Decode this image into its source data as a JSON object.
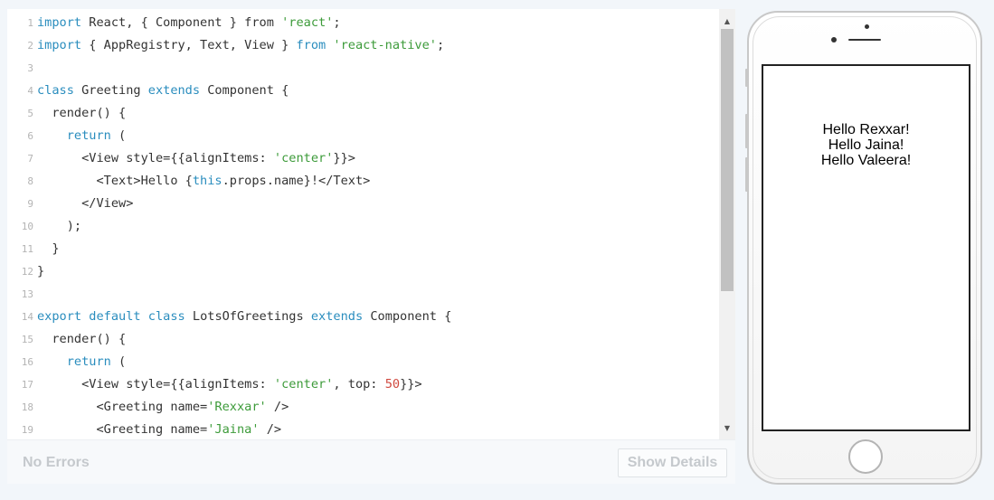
{
  "editor": {
    "lines": [
      [
        [
          "kw",
          "import"
        ],
        [
          "pl",
          " React, { Component } "
        ],
        [
          "pl",
          "from"
        ],
        [
          "pl",
          " "
        ],
        [
          "str",
          "'react'"
        ],
        [
          "pl",
          ";"
        ]
      ],
      [
        [
          "kw",
          "import"
        ],
        [
          "pl",
          " { AppRegistry, Text, View } "
        ],
        [
          "kw",
          "from"
        ],
        [
          "pl",
          " "
        ],
        [
          "str",
          "'react-native'"
        ],
        [
          "pl",
          ";"
        ]
      ],
      [],
      [
        [
          "kw",
          "class"
        ],
        [
          "pl",
          " Greeting "
        ],
        [
          "kw",
          "extends"
        ],
        [
          "pl",
          " Component {"
        ]
      ],
      [
        [
          "pl",
          "  render() {"
        ]
      ],
      [
        [
          "pl",
          "    "
        ],
        [
          "kw",
          "return"
        ],
        [
          "pl",
          " ("
        ]
      ],
      [
        [
          "pl",
          "      <View style={{alignItems: "
        ],
        [
          "str",
          "'center'"
        ],
        [
          "pl",
          "}}>"
        ]
      ],
      [
        [
          "pl",
          "        <Text>Hello {"
        ],
        [
          "kw",
          "this"
        ],
        [
          "pl",
          ".props.name}!</Text>"
        ]
      ],
      [
        [
          "pl",
          "      </View>"
        ]
      ],
      [
        [
          "pl",
          "    );"
        ]
      ],
      [
        [
          "pl",
          "  }"
        ]
      ],
      [
        [
          "pl",
          "}"
        ]
      ],
      [],
      [
        [
          "kw",
          "export"
        ],
        [
          "pl",
          " "
        ],
        [
          "kw",
          "default"
        ],
        [
          "pl",
          " "
        ],
        [
          "kw",
          "class"
        ],
        [
          "pl",
          " LotsOfGreetings "
        ],
        [
          "kw",
          "extends"
        ],
        [
          "pl",
          " Component {"
        ]
      ],
      [
        [
          "pl",
          "  render() {"
        ]
      ],
      [
        [
          "pl",
          "    "
        ],
        [
          "kw",
          "return"
        ],
        [
          "pl",
          " ("
        ]
      ],
      [
        [
          "pl",
          "      <View style={{alignItems: "
        ],
        [
          "str",
          "'center'"
        ],
        [
          "pl",
          ", top: "
        ],
        [
          "num",
          "50"
        ],
        [
          "pl",
          "}}>"
        ]
      ],
      [
        [
          "pl",
          "        <Greeting name="
        ],
        [
          "str",
          "'Rexxar'"
        ],
        [
          "pl",
          " />"
        ]
      ],
      [
        [
          "pl",
          "        <Greeting name="
        ],
        [
          "str",
          "'Jaina'"
        ],
        [
          "pl",
          " />"
        ]
      ]
    ],
    "scroll_up_icon": "▲",
    "scroll_down_icon": "▼"
  },
  "status": {
    "text": "No Errors",
    "details_button": "Show Details"
  },
  "preview": {
    "greetings": [
      "Hello Rexxar!",
      "Hello Jaina!",
      "Hello Valeera!"
    ]
  },
  "colors": {
    "keyword": "#2a8dbe",
    "string": "#3d9b3a",
    "number": "#d0493f",
    "plain": "#333333",
    "line_number": "#b4b4b4"
  }
}
